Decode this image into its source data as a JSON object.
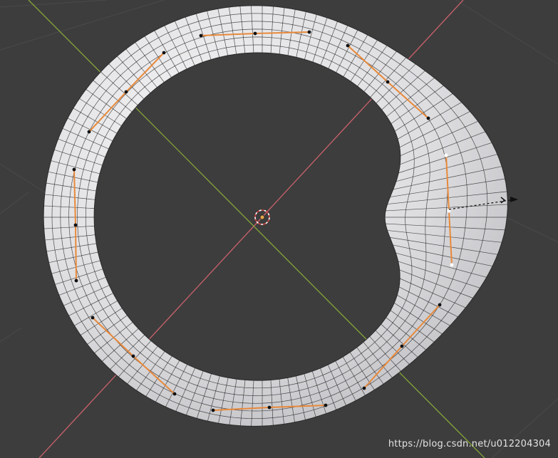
{
  "viewport": {
    "colors": {
      "background": "#3d3d3d",
      "grid_line": "#4a4a4a",
      "x_axis": "#c9616b",
      "y_axis": "#84a53a",
      "mesh_light": "#eeeeef",
      "mesh_shadow": "#a7a7aa",
      "wire": "#1c1c1c",
      "edge_selected": "#e8893a",
      "vertex": "#111111",
      "vertex_active": "#ffffff",
      "origin": "#e6a54a"
    },
    "object_name": "torus-mesh",
    "icons": [
      "3d-cursor-icon",
      "vertex-icon",
      "proportional-edit-arrow-icon"
    ]
  },
  "watermark": {
    "text": "https://blog.csdn.net/u012204304"
  }
}
